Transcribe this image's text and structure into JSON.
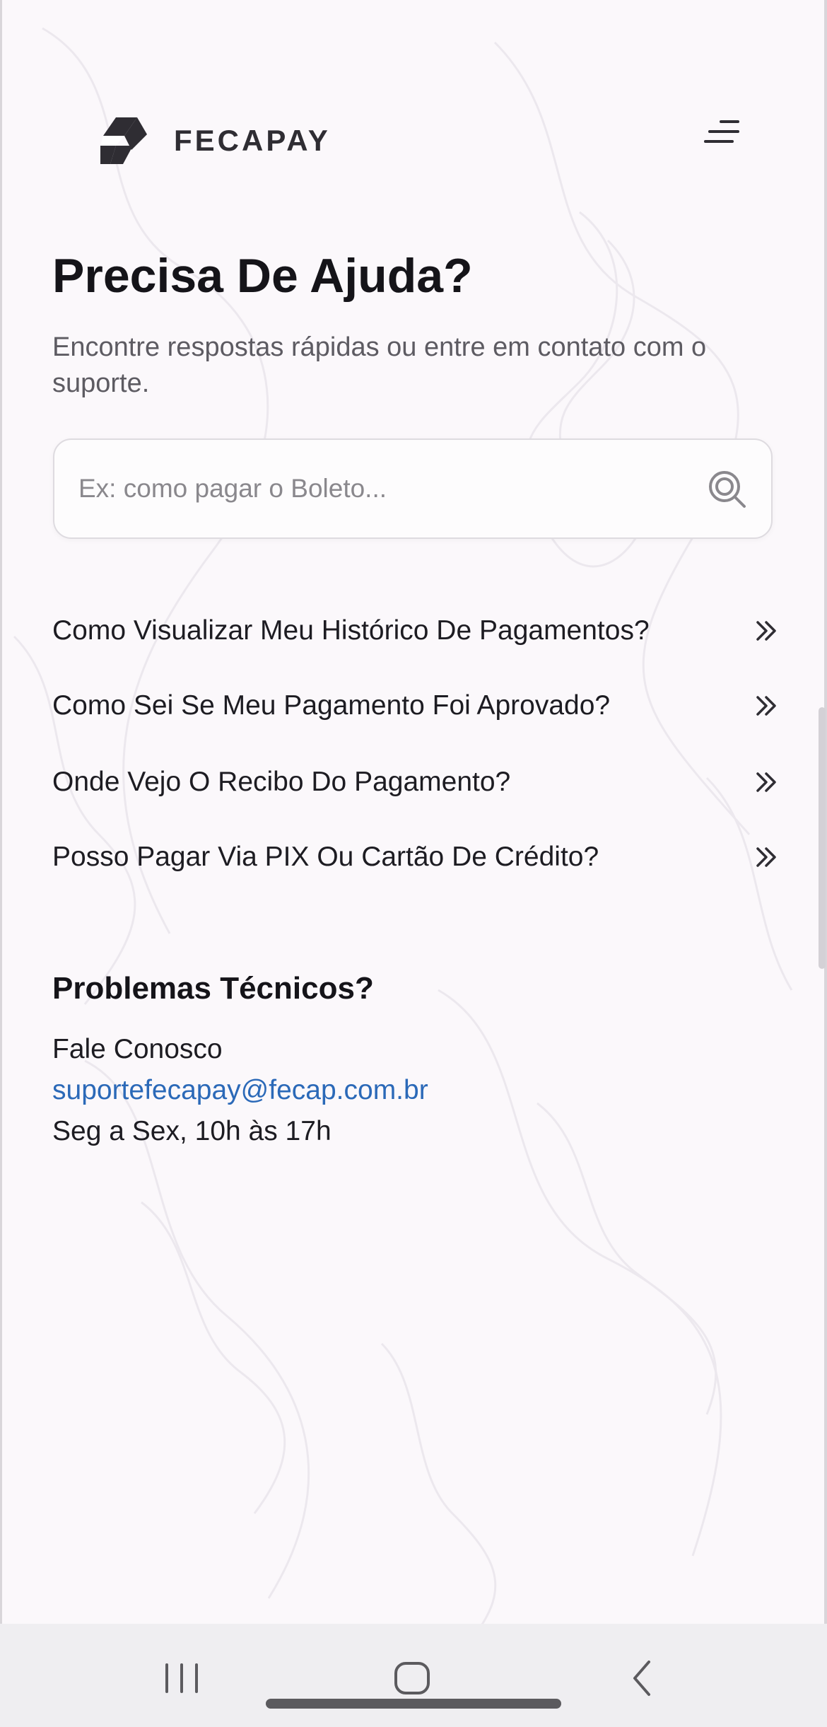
{
  "brand": {
    "name": "FECAPAY",
    "logo_icon": "fecapay-logo-icon",
    "menu_icon": "menu-icon"
  },
  "page": {
    "title": "Precisa De Ajuda?",
    "subtitle": "Encontre respostas rápidas ou entre em contato com o suporte."
  },
  "search": {
    "placeholder": "Ex: como pagar o Boleto...",
    "value": "",
    "icon": "search-icon"
  },
  "faq": {
    "items": [
      {
        "label": "Como Visualizar Meu Histórico De Pagamentos?",
        "icon": "double-chevron-right-icon"
      },
      {
        "label": "Como Sei Se Meu Pagamento Foi Aprovado?",
        "icon": "double-chevron-right-icon"
      },
      {
        "label": "Onde Vejo O Recibo Do Pagamento?",
        "icon": "double-chevron-right-icon"
      },
      {
        "label": "Posso Pagar Via PIX Ou Cartão De Crédito?",
        "icon": "double-chevron-right-icon"
      }
    ]
  },
  "support": {
    "title": "Problemas Técnicos?",
    "contact_label": "Fale Conosco",
    "email": "suportefecapay@fecap.com.br",
    "hours": "Seg a Sex, 10h às 17h"
  },
  "colors": {
    "background": "#fbf8fb",
    "text": "#1c1b20",
    "link": "#2b69b8",
    "nav_bar": "#efeef1"
  },
  "system_nav": {
    "recents_icon": "recents-icon",
    "home_icon": "home-icon",
    "back_icon": "back-icon"
  }
}
